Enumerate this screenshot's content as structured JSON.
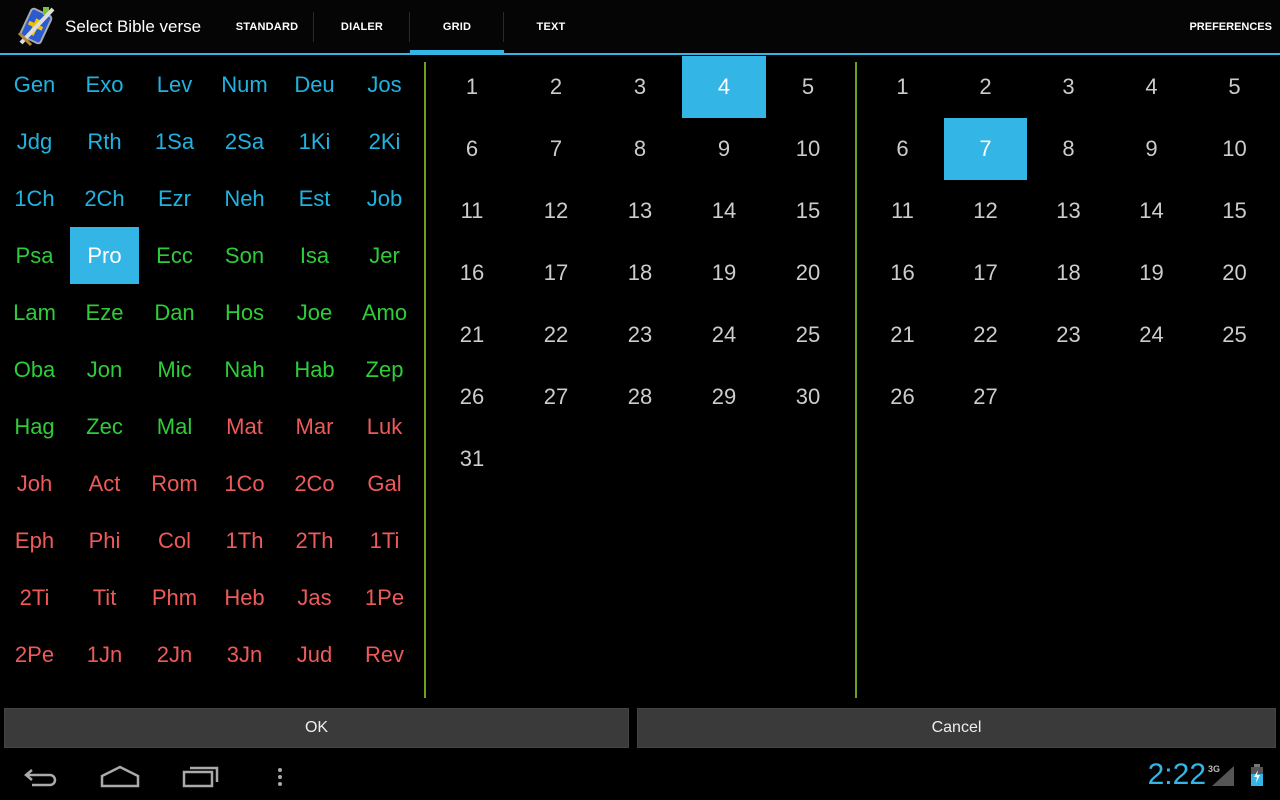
{
  "actionbar": {
    "title": "Select Bible verse",
    "app_icon": "bible-sword-app-icon",
    "tabs": [
      {
        "label": "STANDARD",
        "active": false
      },
      {
        "label": "DIALER",
        "active": false
      },
      {
        "label": "GRID",
        "active": true
      },
      {
        "label": "TEXT",
        "active": false
      }
    ],
    "preferences_label": "PREFERENCES"
  },
  "books": {
    "selected": "Pro",
    "colors": {
      "ot_history": "#1fb3e0",
      "ot_poetry_prophets": "#2fcc3a",
      "nt": "#ee5a5a",
      "selected_bg": "#33b5e5"
    },
    "items": [
      {
        "label": "Gen",
        "group": "ot1"
      },
      {
        "label": "Exo",
        "group": "ot1"
      },
      {
        "label": "Lev",
        "group": "ot1"
      },
      {
        "label": "Num",
        "group": "ot1"
      },
      {
        "label": "Deu",
        "group": "ot1"
      },
      {
        "label": "Jos",
        "group": "ot1"
      },
      {
        "label": "Jdg",
        "group": "ot1"
      },
      {
        "label": "Rth",
        "group": "ot1"
      },
      {
        "label": "1Sa",
        "group": "ot1"
      },
      {
        "label": "2Sa",
        "group": "ot1"
      },
      {
        "label": "1Ki",
        "group": "ot1"
      },
      {
        "label": "2Ki",
        "group": "ot1"
      },
      {
        "label": "1Ch",
        "group": "ot1"
      },
      {
        "label": "2Ch",
        "group": "ot1"
      },
      {
        "label": "Ezr",
        "group": "ot1"
      },
      {
        "label": "Neh",
        "group": "ot1"
      },
      {
        "label": "Est",
        "group": "ot1"
      },
      {
        "label": "Job",
        "group": "ot1"
      },
      {
        "label": "Psa",
        "group": "ot2"
      },
      {
        "label": "Pro",
        "group": "ot2"
      },
      {
        "label": "Ecc",
        "group": "ot2"
      },
      {
        "label": "Son",
        "group": "ot2"
      },
      {
        "label": "Isa",
        "group": "ot2"
      },
      {
        "label": "Jer",
        "group": "ot2"
      },
      {
        "label": "Lam",
        "group": "ot2"
      },
      {
        "label": "Eze",
        "group": "ot2"
      },
      {
        "label": "Dan",
        "group": "ot2"
      },
      {
        "label": "Hos",
        "group": "ot2"
      },
      {
        "label": "Joe",
        "group": "ot2"
      },
      {
        "label": "Amo",
        "group": "ot2"
      },
      {
        "label": "Oba",
        "group": "ot2"
      },
      {
        "label": "Jon",
        "group": "ot2"
      },
      {
        "label": "Mic",
        "group": "ot2"
      },
      {
        "label": "Nah",
        "group": "ot2"
      },
      {
        "label": "Hab",
        "group": "ot2"
      },
      {
        "label": "Zep",
        "group": "ot2"
      },
      {
        "label": "Hag",
        "group": "ot2"
      },
      {
        "label": "Zec",
        "group": "ot2"
      },
      {
        "label": "Mal",
        "group": "ot2"
      },
      {
        "label": "Mat",
        "group": "nt"
      },
      {
        "label": "Mar",
        "group": "nt"
      },
      {
        "label": "Luk",
        "group": "nt"
      },
      {
        "label": "Joh",
        "group": "nt"
      },
      {
        "label": "Act",
        "group": "nt"
      },
      {
        "label": "Rom",
        "group": "nt"
      },
      {
        "label": "1Co",
        "group": "nt"
      },
      {
        "label": "2Co",
        "group": "nt"
      },
      {
        "label": "Gal",
        "group": "nt"
      },
      {
        "label": "Eph",
        "group": "nt"
      },
      {
        "label": "Phi",
        "group": "nt"
      },
      {
        "label": "Col",
        "group": "nt"
      },
      {
        "label": "1Th",
        "group": "nt"
      },
      {
        "label": "2Th",
        "group": "nt"
      },
      {
        "label": "1Ti",
        "group": "nt"
      },
      {
        "label": "2Ti",
        "group": "nt"
      },
      {
        "label": "Tit",
        "group": "nt"
      },
      {
        "label": "Phm",
        "group": "nt"
      },
      {
        "label": "Heb",
        "group": "nt"
      },
      {
        "label": "Jas",
        "group": "nt"
      },
      {
        "label": "1Pe",
        "group": "nt"
      },
      {
        "label": "2Pe",
        "group": "nt"
      },
      {
        "label": "1Jn",
        "group": "nt"
      },
      {
        "label": "2Jn",
        "group": "nt"
      },
      {
        "label": "3Jn",
        "group": "nt"
      },
      {
        "label": "Jud",
        "group": "nt"
      },
      {
        "label": "Rev",
        "group": "nt"
      }
    ]
  },
  "chapters": {
    "count": 31,
    "selected": 4
  },
  "verses": {
    "count": 27,
    "selected": 7
  },
  "buttons": {
    "ok": "OK",
    "cancel": "Cancel"
  },
  "statusbar": {
    "time": "2:22",
    "network": "3G",
    "battery": "charging"
  }
}
